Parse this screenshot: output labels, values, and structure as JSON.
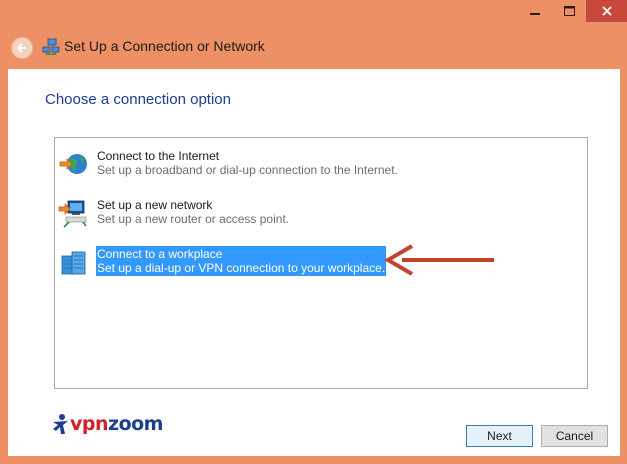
{
  "window": {
    "title": "Set Up a Connection or Network",
    "caption_buttons": [
      "minimize",
      "maximize",
      "close"
    ]
  },
  "heading": "Choose a connection option",
  "options": [
    {
      "title": "Connect to the Internet",
      "description": "Set up a broadband or dial-up connection to the Internet.",
      "icon": "globe-network-icon",
      "selected": false
    },
    {
      "title": "Set up a new network",
      "description": "Set up a new router or access point.",
      "icon": "router-network-icon",
      "selected": false
    },
    {
      "title": "Connect to a workplace",
      "description": "Set up a dial-up or VPN connection to your workplace.",
      "icon": "workplace-network-icon",
      "selected": true
    }
  ],
  "annotation": {
    "icon": "red-arrow-icon",
    "color": "#C0452F"
  },
  "logo": {
    "icon": "vpnzoom-logo",
    "text_red": "vpn",
    "text_blue": "zoom"
  },
  "buttons": {
    "next": "Next",
    "cancel": "Cancel"
  },
  "colors": {
    "frame": "#EE9066",
    "heading": "#1F3D8E",
    "selection": "#3399FF",
    "close_button": "#C7473A"
  }
}
